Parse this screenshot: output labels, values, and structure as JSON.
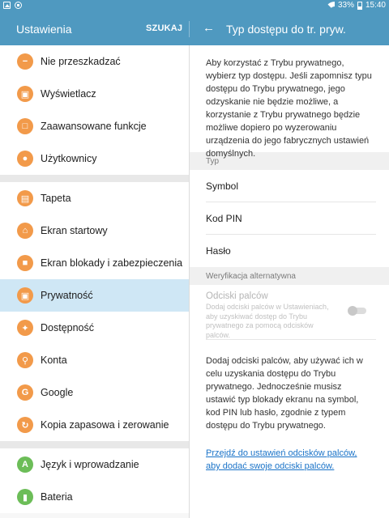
{
  "status_bar": {
    "icons": [
      "image-notification-icon",
      "download-notification-icon"
    ],
    "battery": "33%",
    "time": "15:40"
  },
  "header": {
    "left_title": "Ustawienia",
    "search_label": "SZUKAJ",
    "right_title": "Typ dostępu do tr. pryw."
  },
  "sidebar": {
    "group1": [
      {
        "label": "Nie przeszkadzać",
        "icon": "do-not-disturb-icon"
      },
      {
        "label": "Wyświetlacz",
        "icon": "display-icon"
      },
      {
        "label": "Zaawansowane funkcje",
        "icon": "advanced-features-icon"
      },
      {
        "label": "Użytkownicy",
        "icon": "users-icon"
      }
    ],
    "group2": [
      {
        "label": "Tapeta",
        "icon": "wallpaper-icon"
      },
      {
        "label": "Ekran startowy",
        "icon": "home-icon"
      },
      {
        "label": "Ekran blokady i zabezpieczenia",
        "icon": "lock-icon"
      },
      {
        "label": "Prywatność",
        "icon": "privacy-icon",
        "selected": true
      },
      {
        "label": "Dostępność",
        "icon": "accessibility-icon"
      },
      {
        "label": "Konta",
        "icon": "key-icon"
      },
      {
        "label": "Google",
        "icon": "google-icon"
      },
      {
        "label": "Kopia zapasowa i zerowanie",
        "icon": "backup-icon"
      }
    ],
    "group3": [
      {
        "label": "Język i wprowadzanie",
        "icon": "language-icon"
      },
      {
        "label": "Bateria",
        "icon": "battery-icon"
      }
    ]
  },
  "content": {
    "intro": "Aby korzystać z Trybu prywatnego, wybierz typ dostępu. Jeśli zapomnisz typu dostępu do Trybu prywatnego, jego odzyskanie nie będzie możliwe, a korzystanie z Trybu prywatnego będzie możliwe dopiero po wyzerowaniu urządzenia do jego fabrycznych ustawień domyślnych.",
    "type_header": "Typ",
    "options": [
      "Symbol",
      "Kod PIN",
      "Hasło"
    ],
    "alt_header": "Weryfikacja alternatywna",
    "fingerprint_title": "Odciski palców",
    "fingerprint_desc": "Dodaj odciski palców w Ustawieniach, aby uzyskiwać dostęp do Trybu prywatnego za pomocą odcisków palców.",
    "fingerprint_enabled": false,
    "info": "Dodaj odciski palców, aby używać ich w celu uzyskania dostępu do Trybu prywatnego. Jednocześnie musisz ustawić typ blokady ekranu na symbol, kod PIN lub hasło, zgodnie z typem dostępu do Trybu prywatnego.",
    "link": "Przejdź do ustawień odcisków palców, aby dodać swoje odciski palców."
  },
  "colors": {
    "accent": "#4f99c0",
    "selected": "#cfe7f5",
    "icon_orange": "#f29a4a",
    "icon_green": "#6cbd58",
    "link": "#1a73c8"
  }
}
